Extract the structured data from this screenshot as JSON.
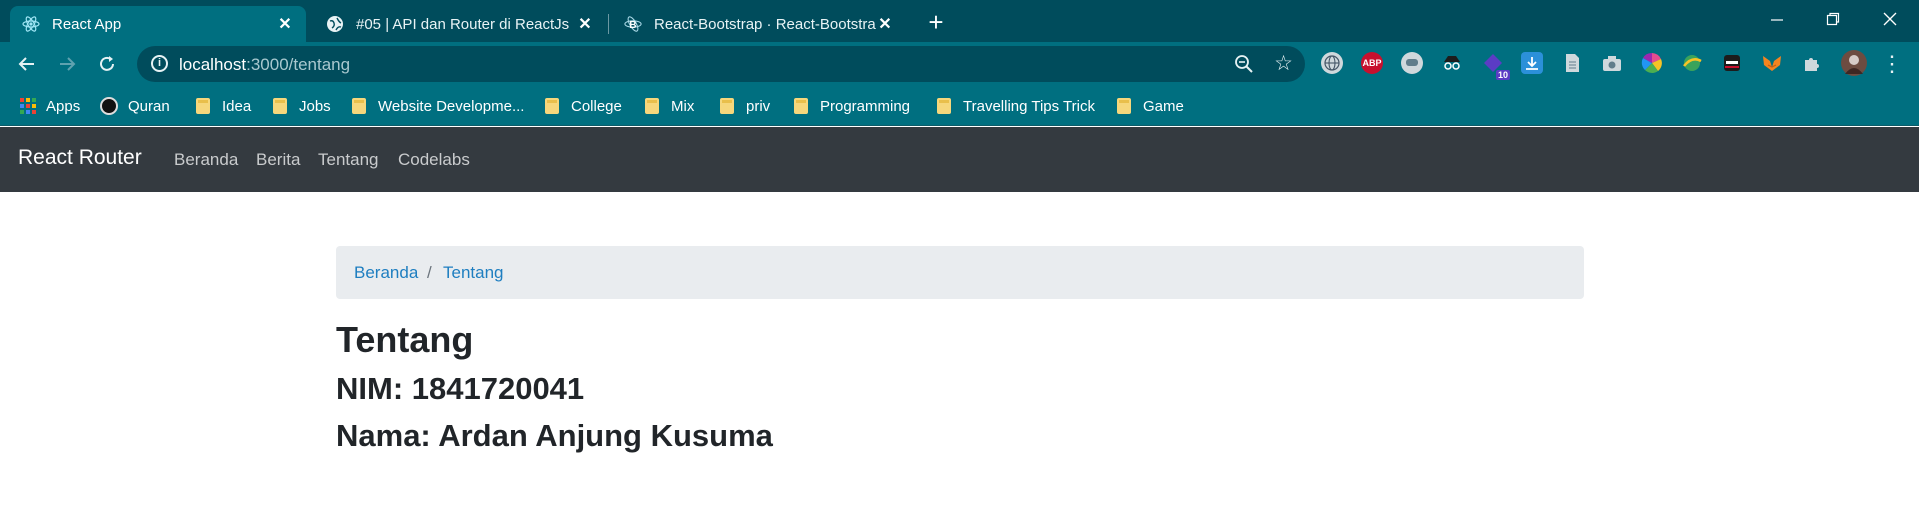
{
  "browser": {
    "tabs": [
      {
        "title": "React App",
        "favicon": "react-icon",
        "active": true
      },
      {
        "title": "#05 | API dan Router di ReactJs",
        "favicon": "globe-icon",
        "active": false
      },
      {
        "title": "React-Bootstrap · React-Bootstrap",
        "favicon": "react-bootstrap-icon",
        "active": false
      }
    ],
    "address": {
      "host": "localhost",
      "path": ":3000/tentang"
    },
    "extensions": [
      {
        "name": "globe-extension-icon",
        "color": "#cfd8dc"
      },
      {
        "name": "adblock-plus-icon",
        "label": "ABP",
        "color": "#c8102e"
      },
      {
        "name": "chat-bubble-icon",
        "color": "#cfd8dc"
      },
      {
        "name": "incognito-icon",
        "color": "#1c1c1c"
      },
      {
        "name": "extension-badge-icon",
        "badge": "10",
        "color": "#5b3cc4"
      },
      {
        "name": "download-icon",
        "color": "#2b90d9"
      },
      {
        "name": "document-icon",
        "color": "#cfd8dc"
      },
      {
        "name": "camera-icon",
        "color": "#cfd8dc"
      },
      {
        "name": "color-picker-icon",
        "color": "#e34d8f"
      },
      {
        "name": "globe-green-icon",
        "color": "#3aa35b"
      },
      {
        "name": "ninja-icon",
        "color": "#1c1c1c"
      },
      {
        "name": "metamask-icon",
        "color": "#f5841f"
      },
      {
        "name": "puzzle-icon",
        "color": "#cfd8dc"
      },
      {
        "name": "avatar-icon",
        "color": "#6d4c41"
      }
    ],
    "bookmarks": [
      {
        "label": "Apps",
        "icon": "apps-grid-icon"
      },
      {
        "label": "Quran",
        "icon": "quran-icon"
      },
      {
        "label": "Idea",
        "icon": "folder-icon"
      },
      {
        "label": "Jobs",
        "icon": "folder-icon"
      },
      {
        "label": "Website Developme...",
        "icon": "folder-icon"
      },
      {
        "label": "College",
        "icon": "folder-icon"
      },
      {
        "label": "Mix",
        "icon": "folder-icon"
      },
      {
        "label": "priv",
        "icon": "folder-icon"
      },
      {
        "label": "Programming",
        "icon": "folder-icon"
      },
      {
        "label": "Travelling Tips Trick",
        "icon": "folder-icon"
      },
      {
        "label": "Game",
        "icon": "folder-icon"
      }
    ]
  },
  "navbar": {
    "brand": "React Router",
    "links": [
      "Beranda",
      "Berita",
      "Tentang",
      "Codelabs"
    ]
  },
  "breadcrumb": {
    "items": [
      "Beranda",
      "Tentang"
    ],
    "separator": "/"
  },
  "content": {
    "title": "Tentang",
    "nim": "NIM: 1841720041",
    "nama": "Nama: Ardan Anjung Kusuma"
  },
  "colors": {
    "tabstrip": "#004c5c",
    "toolbar": "#006f80",
    "navbar": "#343a40",
    "breadcrumb_bg": "#e9ecef",
    "link": "#1e7ec0"
  }
}
